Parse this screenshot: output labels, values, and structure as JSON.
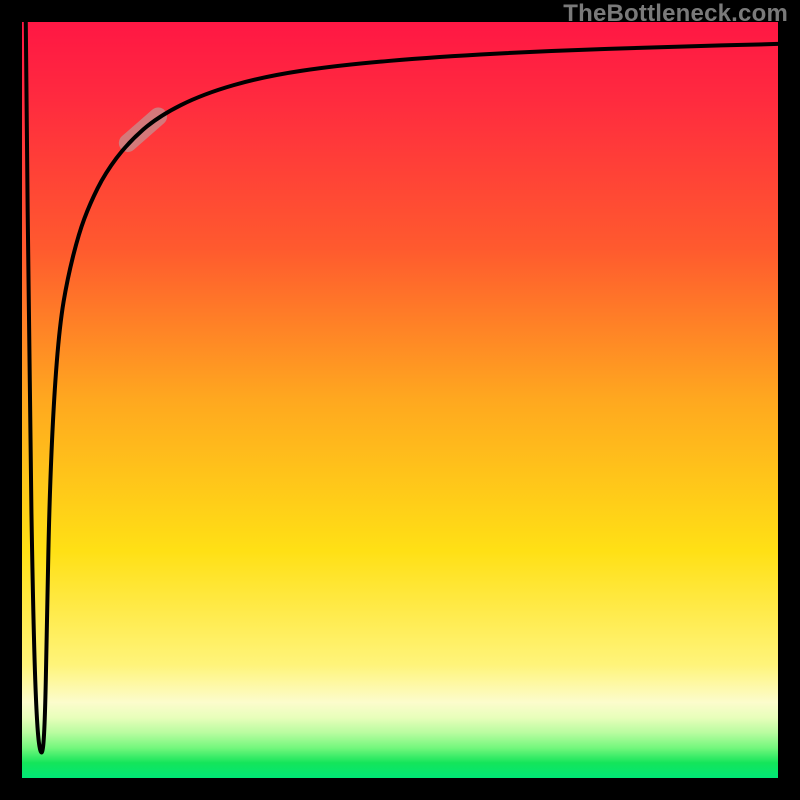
{
  "watermark": "TheBottleneck.com",
  "chart_data": {
    "type": "line",
    "title": "",
    "xlabel": "",
    "ylabel": "",
    "xlim": [
      0,
      100
    ],
    "ylim": [
      0,
      100
    ],
    "grid": false,
    "legend": false,
    "series": [
      {
        "name": "curve",
        "x": [
          0.5,
          1.0,
          1.5,
          2.0,
          2.6,
          3.0,
          3.3,
          3.6,
          4.2,
          5.0,
          6.0,
          7.5,
          9.0,
          11.0,
          14.0,
          18.0,
          24.0,
          32.0,
          42.0,
          55.0,
          70.0,
          85.0,
          100.0
        ],
        "y": [
          100.0,
          50.0,
          20.0,
          6.0,
          2.5,
          6.0,
          20.0,
          36.0,
          50.0,
          60.0,
          66.0,
          72.0,
          76.0,
          80.0,
          84.0,
          87.5,
          90.5,
          92.8,
          94.3,
          95.4,
          96.2,
          96.7,
          97.1
        ]
      }
    ],
    "annotations": [
      {
        "name": "highlight-segment",
        "x_range": [
          14.0,
          20.0
        ],
        "style": "thick-translucent"
      }
    ]
  },
  "colors": {
    "curve_stroke": "#000000",
    "highlight_stroke": "#c59090",
    "frame": "#000000"
  }
}
